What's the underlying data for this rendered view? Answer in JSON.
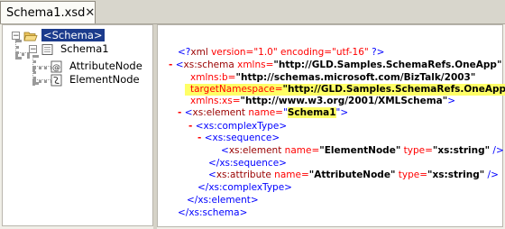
{
  "tab": {
    "title": "Schema1.xsd",
    "close": "✕"
  },
  "tree": {
    "root": {
      "label": "<Schema>",
      "expander": "−"
    },
    "schema": {
      "label": "Schema1",
      "expander": "−"
    },
    "children": [
      {
        "label": "AttributeNode",
        "icon": "attribute-icon"
      },
      {
        "label": "ElementNode",
        "icon": "element-icon"
      }
    ]
  },
  "code": {
    "decl": {
      "open": "<?",
      "name": "xml",
      "attrs": " version=\"1.0\" encoding=\"utf-16\" ",
      "close": "?>"
    },
    "schema_open": {
      "minus": "-",
      "lt": "<",
      "tag": "xs:schema",
      "attr": " xmlns=",
      "val": "\"http://GLD.Samples.SchemaRefs.OneApp\""
    },
    "xmlns_b": {
      "attr": "xmlns:b=",
      "val": "\"http://schemas.microsoft.com/BizTalk/2003\""
    },
    "target_ns": {
      "attr": "targetNamespace=",
      "val": "\"http://GLD.Samples.SchemaRefs.OneApp\""
    },
    "xmlns_xs": {
      "attr": "xmlns:xs=",
      "val": "\"http://www.w3.org/2001/XMLSchema\"",
      "gt": ">"
    },
    "element_open": {
      "minus": "-",
      "lt": "<",
      "tag": "xs:element",
      "attr": " name=",
      "q1": "\"",
      "val": "Schema1",
      "q2": "\"",
      "gt": ">"
    },
    "complex_open": {
      "minus": "-",
      "text": "<xs:complexType>"
    },
    "sequence_open": {
      "minus": "-",
      "text": "<xs:sequence>"
    },
    "inner_element": {
      "lt": "<",
      "tag": "xs:element",
      "a1": " name=",
      "v1": "\"ElementNode\"",
      "a2": " type=",
      "v2": "\"xs:string\"",
      "end": " />"
    },
    "sequence_close": "</xs:sequence>",
    "attribute": {
      "lt": "<",
      "tag": "xs:attribute",
      "a1": " name=",
      "v1": "\"AttributeNode\"",
      "a2": " type=",
      "v2": "\"xs:string\"",
      "end": " />"
    },
    "complex_close": "</xs:complexType>",
    "element_close": "</xs:element>",
    "schema_close": "</xs:schema>"
  }
}
